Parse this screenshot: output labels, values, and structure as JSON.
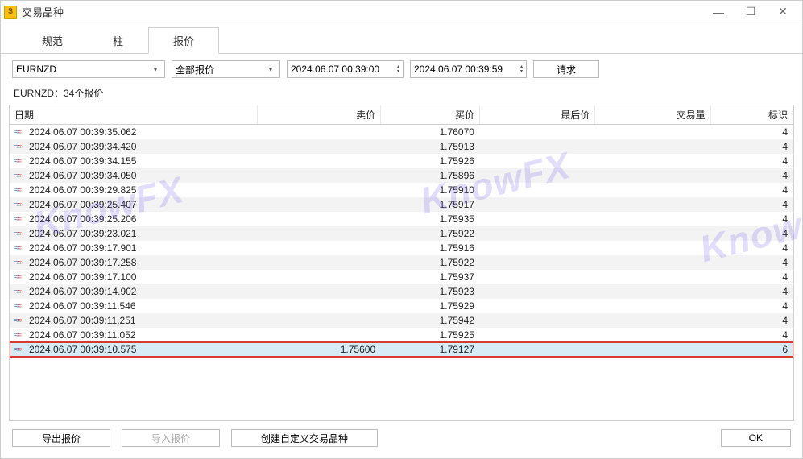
{
  "window": {
    "title": "交易品种"
  },
  "tabs": {
    "spec": "规范",
    "bar": "柱",
    "quote": "报价"
  },
  "filters": {
    "symbol": "EURNZD",
    "quoteType": "全部报价",
    "from": "2024.06.07 00:39:00",
    "to": "2024.06.07 00:39:59",
    "requestBtn": "请求"
  },
  "summary": "EURNZD：34个报价",
  "columns": {
    "date": "日期",
    "sell": "卖价",
    "buy": "买价",
    "last": "最后价",
    "volume": "交易量",
    "flag": "标识"
  },
  "rows": [
    {
      "date": "2024.06.07 00:39:35.062",
      "sell": "",
      "buy": "1.76070",
      "last": "",
      "vol": "",
      "flag": "4",
      "hl": false
    },
    {
      "date": "2024.06.07 00:39:34.420",
      "sell": "",
      "buy": "1.75913",
      "last": "",
      "vol": "",
      "flag": "4",
      "hl": false
    },
    {
      "date": "2024.06.07 00:39:34.155",
      "sell": "",
      "buy": "1.75926",
      "last": "",
      "vol": "",
      "flag": "4",
      "hl": false
    },
    {
      "date": "2024.06.07 00:39:34.050",
      "sell": "",
      "buy": "1.75896",
      "last": "",
      "vol": "",
      "flag": "4",
      "hl": false
    },
    {
      "date": "2024.06.07 00:39:29.825",
      "sell": "",
      "buy": "1.75910",
      "last": "",
      "vol": "",
      "flag": "4",
      "hl": false
    },
    {
      "date": "2024.06.07 00:39:25.407",
      "sell": "",
      "buy": "1.75917",
      "last": "",
      "vol": "",
      "flag": "4",
      "hl": false
    },
    {
      "date": "2024.06.07 00:39:25.206",
      "sell": "",
      "buy": "1.75935",
      "last": "",
      "vol": "",
      "flag": "4",
      "hl": false
    },
    {
      "date": "2024.06.07 00:39:23.021",
      "sell": "",
      "buy": "1.75922",
      "last": "",
      "vol": "",
      "flag": "4",
      "hl": false
    },
    {
      "date": "2024.06.07 00:39:17.901",
      "sell": "",
      "buy": "1.75916",
      "last": "",
      "vol": "",
      "flag": "4",
      "hl": false
    },
    {
      "date": "2024.06.07 00:39:17.258",
      "sell": "",
      "buy": "1.75922",
      "last": "",
      "vol": "",
      "flag": "4",
      "hl": false
    },
    {
      "date": "2024.06.07 00:39:17.100",
      "sell": "",
      "buy": "1.75937",
      "last": "",
      "vol": "",
      "flag": "4",
      "hl": false
    },
    {
      "date": "2024.06.07 00:39:14.902",
      "sell": "",
      "buy": "1.75923",
      "last": "",
      "vol": "",
      "flag": "4",
      "hl": false
    },
    {
      "date": "2024.06.07 00:39:11.546",
      "sell": "",
      "buy": "1.75929",
      "last": "",
      "vol": "",
      "flag": "4",
      "hl": false
    },
    {
      "date": "2024.06.07 00:39:11.251",
      "sell": "",
      "buy": "1.75942",
      "last": "",
      "vol": "",
      "flag": "4",
      "hl": false
    },
    {
      "date": "2024.06.07 00:39:11.052",
      "sell": "",
      "buy": "1.75925",
      "last": "",
      "vol": "",
      "flag": "4",
      "hl": false
    },
    {
      "date": "2024.06.07 00:39:10.575",
      "sell": "1.75600",
      "buy": "1.79127",
      "last": "",
      "vol": "",
      "flag": "6",
      "hl": true
    }
  ],
  "footer": {
    "export": "导出报价",
    "import": "导入报价",
    "createCustom": "创建自定义交易品种",
    "ok": "OK"
  },
  "watermark": "KnowFX"
}
